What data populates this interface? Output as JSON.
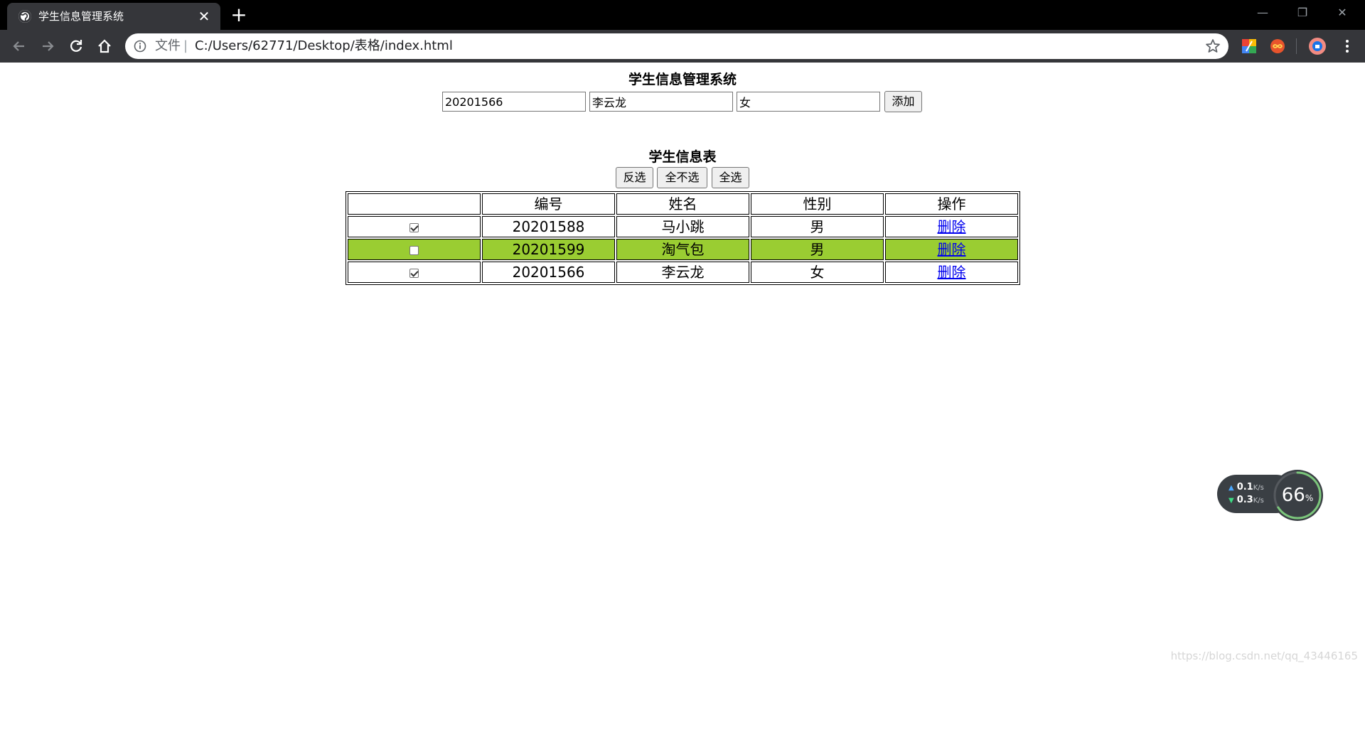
{
  "browser": {
    "tab_title": "学生信息管理系统",
    "tab_close": "✕",
    "new_tab": "+",
    "window_controls": {
      "minimize": "—",
      "restore": "❐",
      "close": "✕"
    },
    "address": {
      "scheme_label": "文件",
      "separator": "|",
      "url": "C:/Users/62771/Desktop/表格/index.html"
    },
    "icons": [
      "back-icon",
      "forward-icon",
      "reload-icon",
      "home-icon",
      "info-icon",
      "star-icon",
      "menu-icon"
    ]
  },
  "page": {
    "title": "学生信息管理系统",
    "form": {
      "id_value": "20201566",
      "name_value": "李云龙",
      "gender_value": "女",
      "add_label": "添加"
    },
    "table_title": "学生信息表",
    "controls": {
      "invert_label": "反选",
      "none_label": "全不选",
      "all_label": "全选"
    },
    "table": {
      "headers": [
        "",
        "编号",
        "姓名",
        "性别",
        "操作"
      ],
      "rows": [
        {
          "checked": true,
          "id": "20201588",
          "name": "马小跳",
          "gender": "男",
          "action": "删除",
          "highlighted": false
        },
        {
          "checked": false,
          "id": "20201599",
          "name": "淘气包",
          "gender": "男",
          "action": "删除",
          "highlighted": true
        },
        {
          "checked": true,
          "id": "20201566",
          "name": "李云龙",
          "gender": "女",
          "action": "删除",
          "highlighted": false
        }
      ],
      "highlight_color": "#9acd32"
    }
  },
  "speed_widget": {
    "upload": "0.1",
    "download": "0.3",
    "unit": "K/s",
    "percent_value": "66",
    "percent_sign": "%",
    "percent": 66
  },
  "watermark": "https://blog.csdn.net/qq_43446165"
}
